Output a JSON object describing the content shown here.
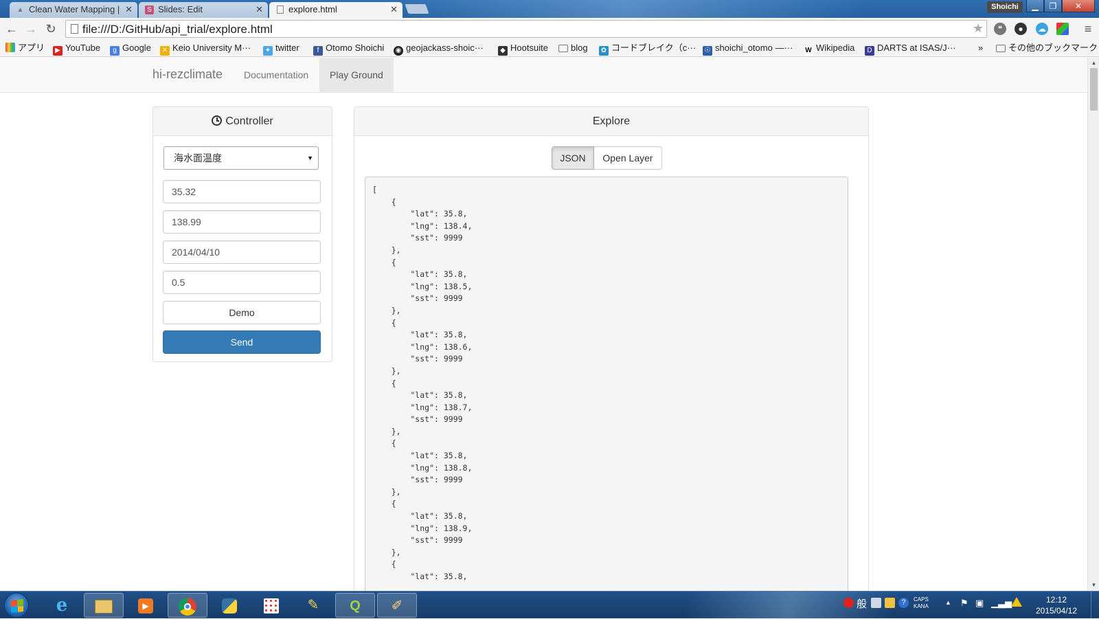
{
  "browser": {
    "tabs": [
      {
        "title": "Clean Water Mapping |"
      },
      {
        "title": "Slides: Edit"
      },
      {
        "title": "explore.html"
      }
    ],
    "profile": "Shoichi",
    "url": "file:///D:/GitHub/api_trial/explore.html",
    "bookmarks": [
      {
        "label": "アプリ"
      },
      {
        "label": "YouTube"
      },
      {
        "label": "Google"
      },
      {
        "label": "Keio University M···"
      },
      {
        "label": "twitter"
      },
      {
        "label": "Otomo Shoichi"
      },
      {
        "label": "geojackass-shoic···"
      },
      {
        "label": "Hootsuite"
      },
      {
        "label": "blog"
      },
      {
        "label": "コードブレイク（c···"
      },
      {
        "label": "shoichi_otomo —···"
      },
      {
        "label": "Wikipedia"
      },
      {
        "label": "DARTS at ISAS/J···"
      }
    ],
    "bookmarks_overflow": "»",
    "other_bookmarks": "その他のブックマーク"
  },
  "nav": {
    "brand": "hi-rezclimate",
    "links": [
      {
        "label": "Documentation"
      },
      {
        "label": "Play Ground"
      }
    ]
  },
  "controller": {
    "title": "Controller",
    "dataset": "海水面温度",
    "lat": "35.32",
    "lng": "138.99",
    "date": "2014/04/10",
    "range": "0.5",
    "demo_label": "Demo",
    "send_label": "Send"
  },
  "explore": {
    "title": "Explore",
    "tab_json": "JSON",
    "tab_openlayer": "Open Layer",
    "json_text": "[\n    {\n        \"lat\": 35.8,\n        \"lng\": 138.4,\n        \"sst\": 9999\n    },\n    {\n        \"lat\": 35.8,\n        \"lng\": 138.5,\n        \"sst\": 9999\n    },\n    {\n        \"lat\": 35.8,\n        \"lng\": 138.6,\n        \"sst\": 9999\n    },\n    {\n        \"lat\": 35.8,\n        \"lng\": 138.7,\n        \"sst\": 9999\n    },\n    {\n        \"lat\": 35.8,\n        \"lng\": 138.8,\n        \"sst\": 9999\n    },\n    {\n        \"lat\": 35.8,\n        \"lng\": 138.9,\n        \"sst\": 9999\n    },\n    {\n        \"lat\": 35.8,"
  },
  "taskbar": {
    "tray_ime": "般",
    "tray_caps": "CAPS",
    "tray_kana": "KANA",
    "time": "12:12",
    "date": "2015/04/12"
  },
  "colors": {
    "primary": "#337ab7",
    "navbar": "#f8f8f8",
    "taskbar": "#1f4f86"
  }
}
